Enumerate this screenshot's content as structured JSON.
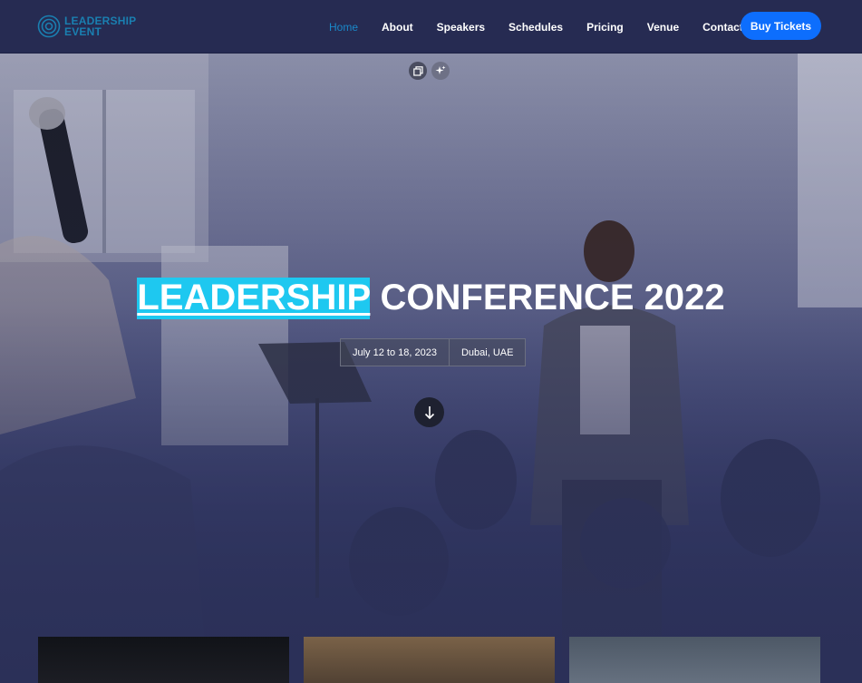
{
  "brand": {
    "name_line1": "LEADERSHIP",
    "name_line2": "EVENT",
    "color": "#1a7fb0"
  },
  "nav": {
    "items": [
      {
        "label": "Home",
        "active": true
      },
      {
        "label": "About",
        "active": false
      },
      {
        "label": "Speakers",
        "active": false
      },
      {
        "label": "Schedules",
        "active": false
      },
      {
        "label": "Pricing",
        "active": false
      },
      {
        "label": "Venue",
        "active": false
      },
      {
        "label": "Contact",
        "active": false
      }
    ],
    "cta_label": "Buy Tickets",
    "cta_color": "#0d6efd"
  },
  "hero": {
    "title_highlight": "LEADERSHIP",
    "title_rest": " CONFERENCE 2022",
    "highlight_color": "#1ec8f0",
    "date": "July 12 to 18, 2023",
    "location": "Dubai, UAE",
    "tool_icons": [
      "gallery-icon",
      "sparkle-icon"
    ],
    "scroll_icon": "arrow-down-icon"
  },
  "cards": [
    {
      "name": "event-photo-1"
    },
    {
      "name": "event-photo-2"
    },
    {
      "name": "event-photo-3"
    }
  ]
}
